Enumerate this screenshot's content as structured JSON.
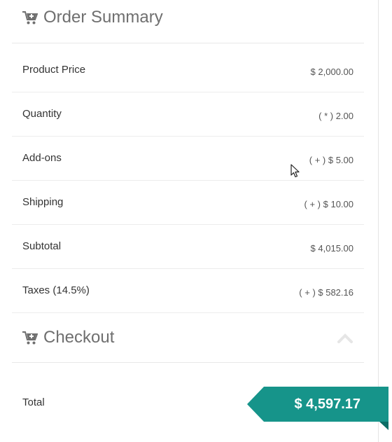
{
  "order_summary": {
    "title": "Order Summary",
    "icon": "cart-plus-icon"
  },
  "rows": [
    {
      "label": "Product Price",
      "value": "$ 2,000.00"
    },
    {
      "label": "Quantity",
      "value": "( * ) 2.00"
    },
    {
      "label": "Add-ons",
      "value": "( + ) $ 5.00"
    },
    {
      "label": "Shipping",
      "value": "( + ) $ 10.00"
    },
    {
      "label": "Subtotal",
      "value": "$ 4,015.00"
    },
    {
      "label": "Taxes (14.5%)",
      "value": "( + ) $ 582.16"
    }
  ],
  "checkout": {
    "title": "Checkout",
    "icon": "cart-plus-icon",
    "toggle_icon": "chevron-up-icon"
  },
  "total": {
    "label": "Total",
    "amount": "$ 4,597.17"
  },
  "colors": {
    "accent": "#16948a",
    "accent_dark": "#0c6e66",
    "heading": "#6f6f6f",
    "text": "#333333"
  }
}
